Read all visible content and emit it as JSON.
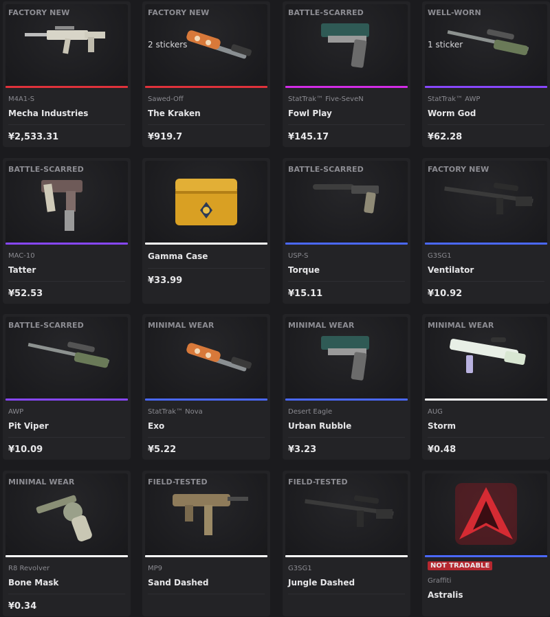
{
  "items": [
    {
      "wear": "FACTORY NEW",
      "type": "M4A1-S",
      "name": "Mecha Industries",
      "price": "¥2,533.31",
      "color": "#e0323b",
      "stickers": "",
      "art": "rifle-m4"
    },
    {
      "wear": "FACTORY NEW",
      "type": "Sawed-Off",
      "name": "The Kraken",
      "price": "¥919.7",
      "color": "#e0323b",
      "stickers": "2 stickers",
      "art": "shotgun"
    },
    {
      "wear": "BATTLE-SCARRED",
      "type": "StatTrak™ Five-SeveN",
      "name": "Fowl Play",
      "price": "¥145.17",
      "color": "#d22ce6",
      "stickers": "",
      "art": "pistol"
    },
    {
      "wear": "WELL-WORN",
      "type": "StatTrak™ AWP",
      "name": "Worm God",
      "price": "¥62.28",
      "color": "#8847ff",
      "stickers": "1 sticker",
      "art": "sniper"
    },
    {
      "wear": "BATTLE-SCARRED",
      "type": "MAC-10",
      "name": "Tatter",
      "price": "¥52.53",
      "color": "#8847ff",
      "stickers": "",
      "art": "smg-mac"
    },
    {
      "wear": "",
      "type": "",
      "name": "Gamma Case",
      "price": "¥33.99",
      "color": "#ffffff",
      "stickers": "",
      "art": "case"
    },
    {
      "wear": "BATTLE-SCARRED",
      "type": "USP-S",
      "name": "Torque",
      "price": "¥15.11",
      "color": "#4b69ff",
      "stickers": "",
      "art": "pistol-usp"
    },
    {
      "wear": "FACTORY NEW",
      "type": "G3SG1",
      "name": "Ventilator",
      "price": "¥10.92",
      "color": "#4b69ff",
      "stickers": "",
      "art": "auto-sniper"
    },
    {
      "wear": "BATTLE-SCARRED",
      "type": "AWP",
      "name": "Pit Viper",
      "price": "¥10.09",
      "color": "#8847ff",
      "stickers": "",
      "art": "sniper"
    },
    {
      "wear": "MINIMAL WEAR",
      "type": "StatTrak™ Nova",
      "name": "Exo",
      "price": "¥5.22",
      "color": "#4b69ff",
      "stickers": "",
      "art": "shotgun"
    },
    {
      "wear": "MINIMAL WEAR",
      "type": "Desert Eagle",
      "name": "Urban Rubble",
      "price": "¥3.23",
      "color": "#4b69ff",
      "stickers": "",
      "art": "pistol"
    },
    {
      "wear": "MINIMAL WEAR",
      "type": "AUG",
      "name": "Storm",
      "price": "¥0.48",
      "color": "#ffffff",
      "stickers": "",
      "art": "aug"
    },
    {
      "wear": "MINIMAL WEAR",
      "type": "R8 Revolver",
      "name": "Bone Mask",
      "price": "¥0.34",
      "color": "#ffffff",
      "stickers": "",
      "art": "revolver"
    },
    {
      "wear": "FIELD-TESTED",
      "type": "MP9",
      "name": "Sand Dashed",
      "price": "",
      "color": "#ffffff",
      "stickers": "",
      "art": "smg-mp9"
    },
    {
      "wear": "FIELD-TESTED",
      "type": "G3SG1",
      "name": "Jungle Dashed",
      "price": "",
      "color": "#ffffff",
      "stickers": "",
      "art": "auto-sniper"
    },
    {
      "wear": "",
      "type": "Graffiti",
      "name": "Astralis",
      "price": "",
      "color": "#4b69ff",
      "stickers": "",
      "art": "graffiti",
      "badge": "NOT TRADABLE"
    }
  ]
}
